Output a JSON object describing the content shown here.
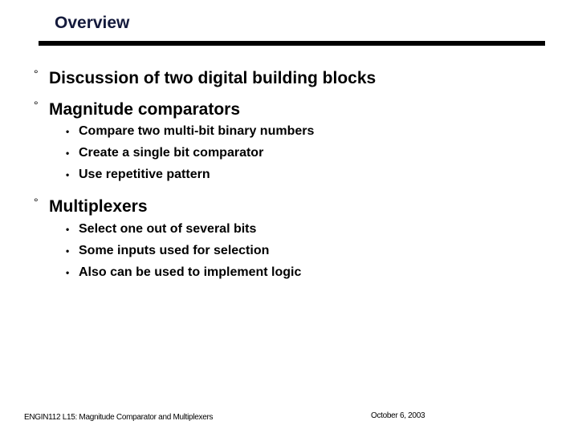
{
  "slide": {
    "title": "Overview",
    "bullets": [
      {
        "marker": "°",
        "text": "Discussion of two digital building blocks",
        "children": []
      },
      {
        "marker": "°",
        "text": "Magnitude comparators",
        "children": [
          {
            "marker": "•",
            "text": "Compare two multi-bit binary numbers"
          },
          {
            "marker": "•",
            "text": "Create a single bit comparator"
          },
          {
            "marker": "•",
            "text": "Use repetitive pattern"
          }
        ]
      },
      {
        "marker": "°",
        "text": "Multiplexers",
        "children": [
          {
            "marker": "•",
            "text": "Select one out of several bits"
          },
          {
            "marker": "•",
            "text": "Some inputs used for selection"
          },
          {
            "marker": "•",
            "text": "Also can be used to implement logic"
          }
        ]
      }
    ]
  },
  "footer": {
    "course": "ENGIN112  L15: Magnitude Comparator and Multiplexers",
    "date": "October 6, 2003"
  }
}
